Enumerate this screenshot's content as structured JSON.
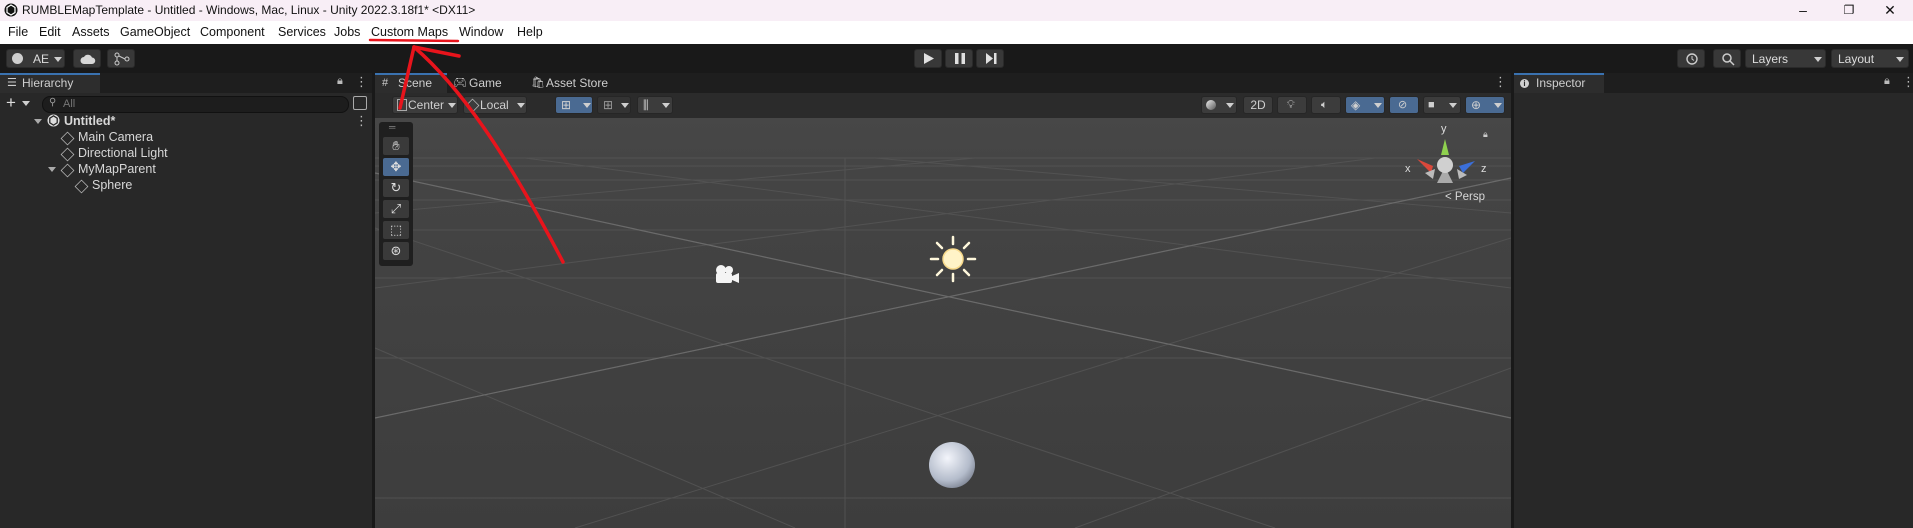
{
  "window": {
    "title": "RUMBLEMapTemplate - Untitled - Windows, Mac, Linux - Unity 2022.3.18f1* <DX11>",
    "minimize": "–",
    "maximize": "❐",
    "close": "✕"
  },
  "menu": {
    "items": [
      "File",
      "Edit",
      "Assets",
      "GameObject",
      "Component",
      "Services",
      "Jobs",
      "Custom Maps",
      "Window",
      "Help"
    ]
  },
  "toolbar": {
    "account_label": "AE",
    "layers_label": "Layers",
    "layout_label": "Layout"
  },
  "hierarchy": {
    "tab_label": "Hierarchy",
    "search_placeholder": "All",
    "scene_name": "Untitled*",
    "items": [
      "Main Camera",
      "Directional Light",
      "MyMapParent",
      "Sphere"
    ]
  },
  "scene_view": {
    "tabs": [
      "Scene",
      "Game",
      "Asset Store"
    ],
    "pivot_label": "Center",
    "space_label": "Local",
    "mode_2d_label": "2D",
    "projection_label": "Persp",
    "gizmo_axes": {
      "x": "x",
      "y": "y",
      "z": "z"
    }
  },
  "inspector": {
    "tab_label": "Inspector"
  },
  "colors": {
    "accent": "#3a72b0",
    "annotation": "#e8141c",
    "panel_bg": "#282828",
    "scene_bg": "#444444"
  }
}
